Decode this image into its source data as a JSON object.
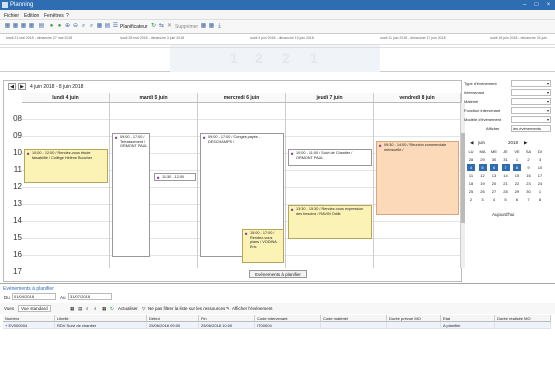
{
  "window": {
    "title": "Planning"
  },
  "menu": [
    "Fichier",
    "Edition",
    "Fenêtres",
    "?"
  ],
  "toolbar": {
    "planificateur": "Planificateur",
    "supprimer": "Supprimer"
  },
  "timeline": {
    "ranges": [
      "lundi 21 mai 2018 - dimanche 27 mai 2018",
      "lundi 28 mai 2018 - dimanche 3 juin 2018",
      "lundi 4 juin 2018 - dimanche 10 juin 2018",
      "lundi 11 juin 2018 - dimanche 17 juin 2018",
      "lundi 18 juin 2018 - dimanche 24 juin"
    ],
    "counts": [
      "1",
      "2",
      "2",
      "1"
    ]
  },
  "calendar": {
    "date_range": "4 juin 2018 - 8 juin 2018",
    "days": [
      "lundi 4 juin",
      "mardi 5 juin",
      "mercredi 6 juin",
      "jeudi 7 juin",
      "vendredi 8 juin"
    ],
    "hours": [
      "08",
      "09",
      "10",
      "11",
      "12",
      "13",
      "14",
      "15",
      "16",
      "17"
    ],
    "events": {
      "mon1": "10:00 - 12:00 / Rendez-vous étude faisabilité / Collège Hélène Boucher",
      "tue1": "09:00 - 17:00 / Terrassement / ORMONT PAUL",
      "tue2": "11:30 - 12:00",
      "wed1": "09:00 - 17:00 / Congés payés - DESCHAMPS /",
      "wed2": "15:00 - 17:00 / Rendez-vous plans / VODINA Eric",
      "thu1": "10:00 - 11:00 / Suivi de Chantier / ORMONT PAUL",
      "thu2": "13:30 - 15:30 / Rendez-vous expression des besoins / RAVIN Odile",
      "fri1": "09:30 - 14:00 / Réunion commerciale mensuelle /"
    },
    "eap_button": "Evénements à planifier"
  },
  "right_panel": {
    "fields": [
      "Type d'événement",
      "Intervenant",
      "Matériel",
      "Fonction intervenant",
      "Modèle d'événement"
    ],
    "afficher_label": "Afficher",
    "afficher_value": "les événements",
    "minical": {
      "month": "juin",
      "year": "2018",
      "weekdays": [
        "LU",
        "MA",
        "ME",
        "JE",
        "VE",
        "SA",
        "DI"
      ],
      "weeks": [
        [
          "28",
          "29",
          "30",
          "31",
          "1",
          "2",
          "3"
        ],
        [
          "4",
          "5",
          "6",
          "7",
          "8",
          "9",
          "10"
        ],
        [
          "11",
          "12",
          "13",
          "14",
          "15",
          "16",
          "17"
        ],
        [
          "18",
          "19",
          "20",
          "21",
          "22",
          "23",
          "24"
        ],
        [
          "25",
          "26",
          "27",
          "28",
          "29",
          "30",
          "1"
        ],
        [
          "2",
          "3",
          "4",
          "5",
          "6",
          "7",
          "8"
        ]
      ],
      "today_label": "Aujourd'hui"
    }
  },
  "bottom": {
    "title": "Evénements à planifier",
    "du_label": "Du",
    "du_value": "01/04/2018",
    "au_label": "Au",
    "au_value": "31/07/2018",
    "vue_label": "Vues",
    "vue_value": "Vue standard",
    "actualiser": "Actualiser",
    "ne_pas_filtrer": "Ne pas filtrer la liste sur les ressources",
    "afficher_evt": "Afficher l'événement",
    "columns": [
      "Numéro",
      "Libellé",
      "Début",
      "Fin",
      "Code intervenant",
      "Code matériel",
      "Durée prévue MO",
      "Etat",
      "Durée réalisée MO"
    ],
    "row": [
      "EV000004",
      "RDV Suivi de chantier",
      "25/06/2018 09:00",
      "25/06/2018 10:00",
      "IT00004",
      "",
      "",
      "A planifier",
      ""
    ]
  }
}
